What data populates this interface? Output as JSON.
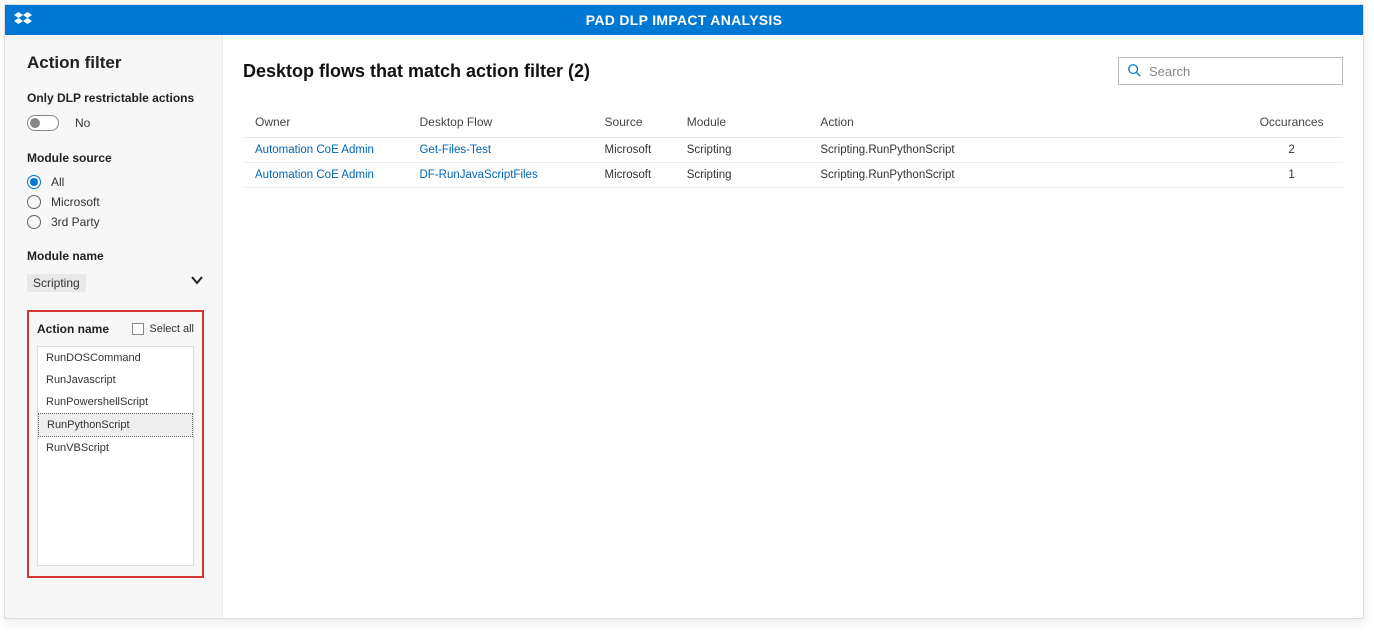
{
  "header": {
    "title": "PAD DLP IMPACT ANALYSIS"
  },
  "sidebar": {
    "title": "Action filter",
    "only_dlp_label": "Only DLP restrictable actions",
    "only_dlp_value": "No",
    "module_source_label": "Module source",
    "module_source_options": [
      {
        "label": "All",
        "selected": true
      },
      {
        "label": "Microsoft",
        "selected": false
      },
      {
        "label": "3rd Party",
        "selected": false
      }
    ],
    "module_name_label": "Module name",
    "module_name_value": "Scripting",
    "action_name_label": "Action name",
    "select_all_label": "Select all",
    "action_items": [
      {
        "label": "RunDOSCommand",
        "selected": false
      },
      {
        "label": "RunJavascript",
        "selected": false
      },
      {
        "label": "RunPowershellScript",
        "selected": false
      },
      {
        "label": "RunPythonScript",
        "selected": true
      },
      {
        "label": "RunVBScript",
        "selected": false
      }
    ]
  },
  "main": {
    "title": "Desktop flows that match action filter (2)",
    "search_placeholder": "Search",
    "columns": {
      "owner": "Owner",
      "flow": "Desktop Flow",
      "source": "Source",
      "module": "Module",
      "action": "Action",
      "occ": "Occurances"
    },
    "rows": [
      {
        "owner": "Automation CoE Admin",
        "flow": "Get-Files-Test",
        "source": "Microsoft",
        "module": "Scripting",
        "action": "Scripting.RunPythonScript",
        "occ": "2"
      },
      {
        "owner": "Automation CoE Admin",
        "flow": "DF-RunJavaScriptFiles",
        "source": "Microsoft",
        "module": "Scripting",
        "action": "Scripting.RunPythonScript",
        "occ": "1"
      }
    ]
  }
}
